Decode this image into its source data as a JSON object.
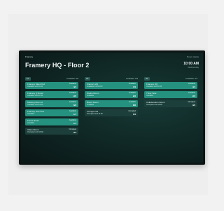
{
  "header": {
    "brand": "Framery",
    "title": "Framery HQ - Floor 2",
    "time": "10:00 AM",
    "date": "Wednesday",
    "top_right": "Room status"
  },
  "columns": [
    {
      "badge": "1F",
      "count": "Available 5/6",
      "rooms": [
        {
          "name": "Framery Meet Pod",
          "sub": "Available until 11:00",
          "status": "Available",
          "count": "4/4",
          "state": "available"
        },
        {
          "name": "Framery Q Room",
          "sub": "Available until 11:30",
          "status": "Available",
          "count": "2/2",
          "state": "available"
        },
        {
          "name": "Meeting Room A",
          "sub": "Available until 12:00",
          "status": "Available",
          "count": "6/6",
          "state": "available"
        },
        {
          "name": "Framery One Pod",
          "sub": "Available",
          "status": "Available",
          "count": "1/1",
          "state": "available"
        },
        {
          "name": "Focus Room",
          "sub": "Available",
          "status": "Available",
          "count": "1/1",
          "state": "available"
        },
        {
          "name": "Video Room",
          "sub": "Occupied until 10:30",
          "status": "Occupied",
          "count": "0/4",
          "state": "occupied"
        }
      ]
    },
    {
      "badge": "2F",
      "count": "Available 3/4",
      "rooms": [
        {
          "name": "Framery 2Q",
          "sub": "Available until 12:00",
          "status": "Available",
          "count": "4/4",
          "state": "available"
        },
        {
          "name": "Studio Room",
          "sub": "Available",
          "status": "Available",
          "count": "2/2",
          "state": "available"
        },
        {
          "name": "Board Room",
          "sub": "Available",
          "status": "Available",
          "count": "8/8",
          "state": "available"
        },
        {
          "name": "Lounge Pod",
          "sub": "Occupied until 11:00",
          "status": "Occupied",
          "count": "0/4",
          "state": "occupied"
        }
      ]
    },
    {
      "badge": "3F",
      "count": "Available 2/3",
      "rooms": [
        {
          "name": "Framery 2Q",
          "sub": "Available until 11:00",
          "status": "Available",
          "count": "4/4",
          "state": "available"
        },
        {
          "name": "Think Tank",
          "sub": "Available",
          "status": "Available",
          "count": "2/2",
          "state": "available"
        },
        {
          "name": "Collaboration Room",
          "sub": "Occupied until 10:45",
          "status": "Occupied",
          "count": "0/6",
          "state": "occupied"
        }
      ]
    }
  ]
}
